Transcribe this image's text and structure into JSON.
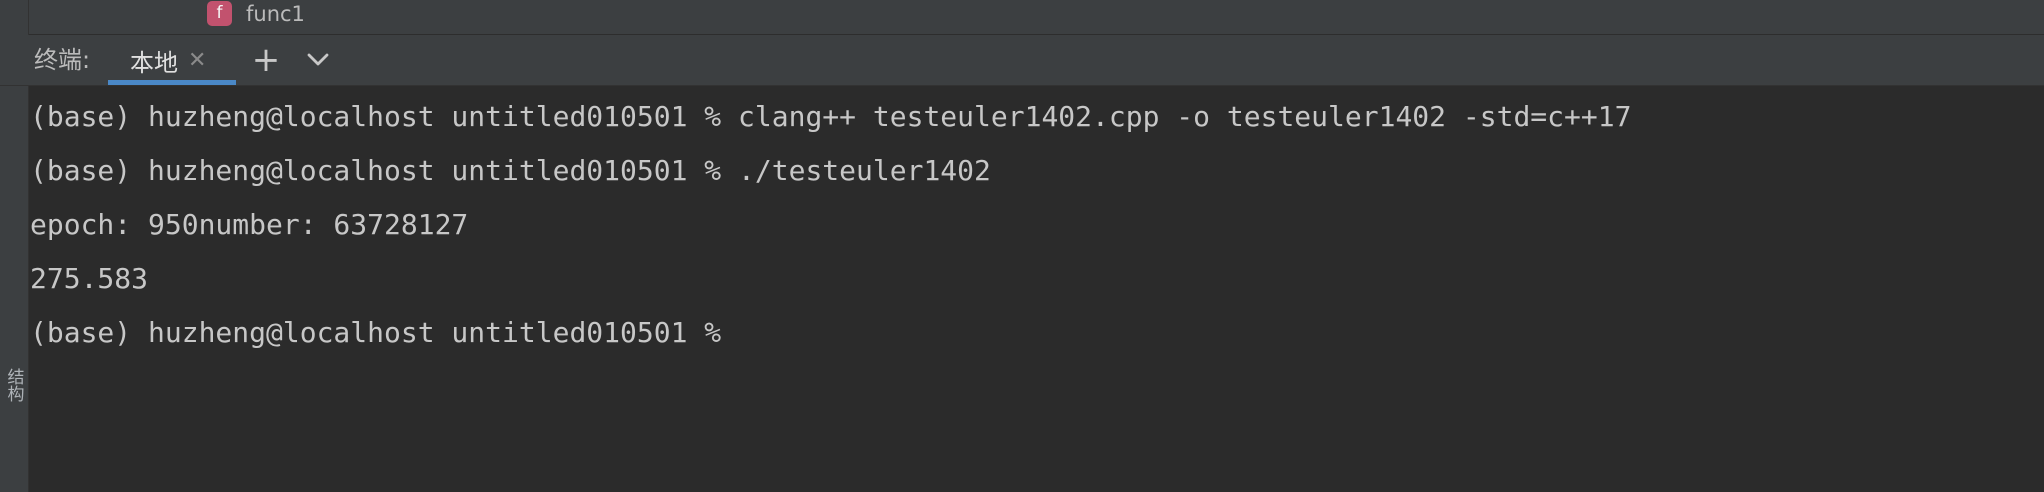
{
  "sidebar": {
    "structure_label": "结构"
  },
  "tree": {
    "item_label": "func1",
    "item_icon": "f"
  },
  "terminal": {
    "title": "终端:",
    "tab_label": "本地",
    "lines": [
      "(base) huzheng@localhost untitled010501 % clang++ testeuler1402.cpp -o testeuler1402 -std=c++17",
      "(base) huzheng@localhost untitled010501 % ./testeuler1402",
      "epoch: 950number: 63728127",
      "275.583",
      "(base) huzheng@localhost untitled010501 %"
    ]
  },
  "colors": {
    "background": "#2b2b2b",
    "panel": "#3c3f41",
    "accent": "#4a88c7",
    "func_icon": "#c2526e"
  }
}
